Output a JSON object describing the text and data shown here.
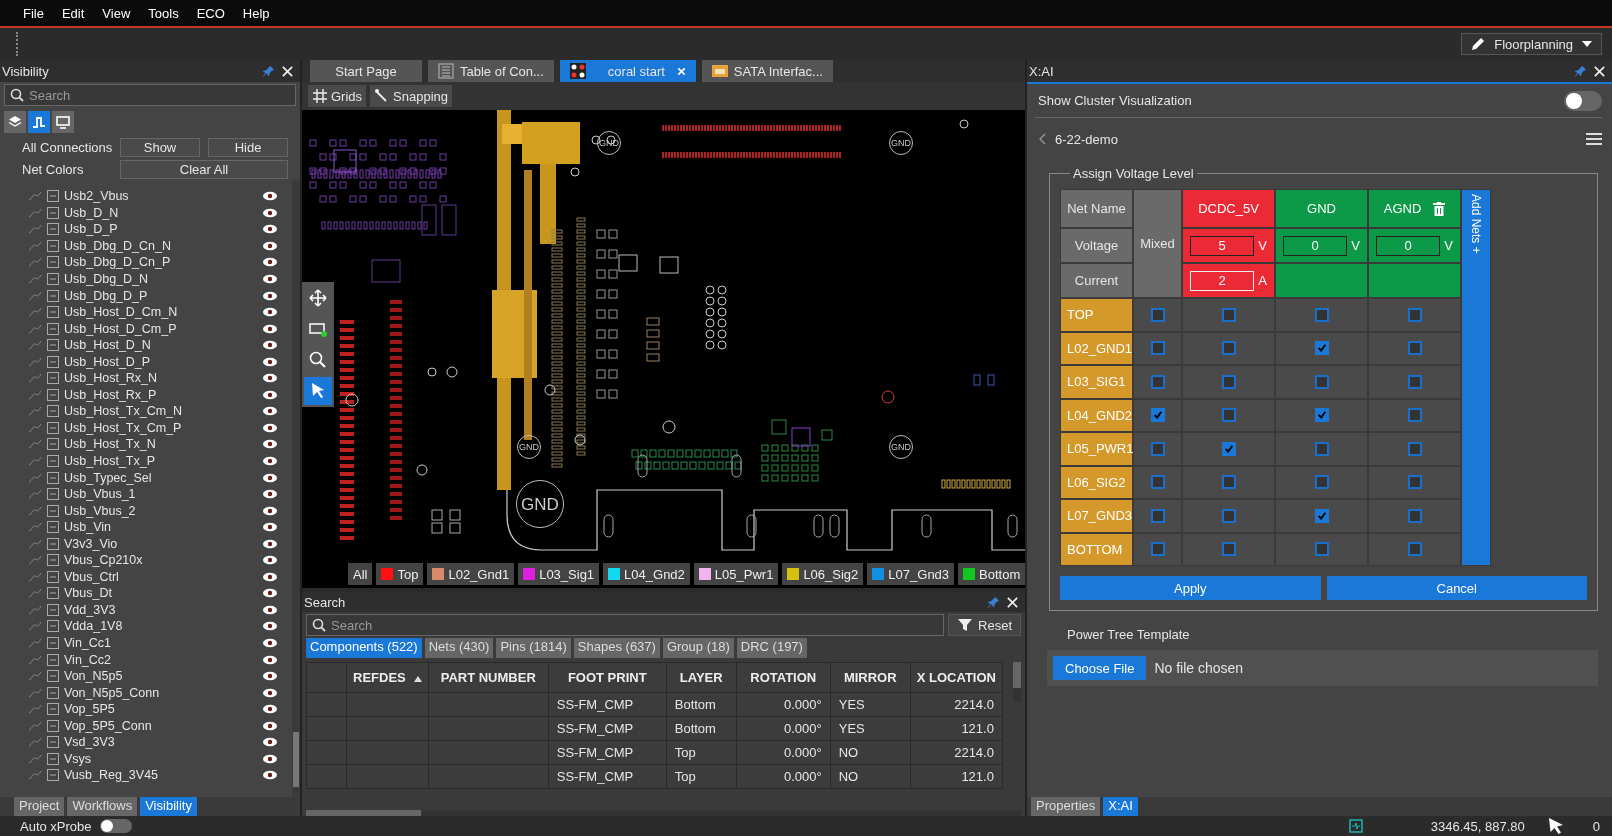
{
  "menu": [
    "File",
    "Edit",
    "View",
    "Tools",
    "ECO",
    "Help"
  ],
  "toolbar": {
    "mode": "Floorplanning"
  },
  "visibility": {
    "title": "Visibility",
    "search_placeholder": "Search",
    "view_icons": [
      {
        "selected": false
      },
      {
        "selected": true
      },
      {
        "selected": false
      }
    ],
    "all_connections": {
      "label": "All Connections",
      "buttons": [
        "Show",
        "Hide"
      ]
    },
    "net_colors": {
      "label": "Net Colors",
      "button": "Clear All"
    },
    "nets": [
      {
        "name": "Usb2_Vbus",
        "visible": true
      },
      {
        "name": "Usb_D_N",
        "visible": true
      },
      {
        "name": "Usb_D_P",
        "visible": true
      },
      {
        "name": "Usb_Dbg_D_Cn_N",
        "visible": true
      },
      {
        "name": "Usb_Dbg_D_Cn_P",
        "visible": true
      },
      {
        "name": "Usb_Dbg_D_N",
        "visible": true
      },
      {
        "name": "Usb_Dbg_D_P",
        "visible": true
      },
      {
        "name": "Usb_Host_D_Cm_N",
        "visible": true
      },
      {
        "name": "Usb_Host_D_Cm_P",
        "visible": true
      },
      {
        "name": "Usb_Host_D_N",
        "visible": true
      },
      {
        "name": "Usb_Host_D_P",
        "visible": true
      },
      {
        "name": "Usb_Host_Rx_N",
        "visible": true
      },
      {
        "name": "Usb_Host_Rx_P",
        "visible": true
      },
      {
        "name": "Usb_Host_Tx_Cm_N",
        "visible": true
      },
      {
        "name": "Usb_Host_Tx_Cm_P",
        "visible": true
      },
      {
        "name": "Usb_Host_Tx_N",
        "visible": true
      },
      {
        "name": "Usb_Host_Tx_P",
        "visible": true
      },
      {
        "name": "Usb_Typec_Sel",
        "visible": true
      },
      {
        "name": "Usb_Vbus_1",
        "visible": true
      },
      {
        "name": "Usb_Vbus_2",
        "visible": true
      },
      {
        "name": "Usb_Vin",
        "visible": true
      },
      {
        "name": "V3v3_Vio",
        "visible": true
      },
      {
        "name": "Vbus_Cp210x",
        "visible": true
      },
      {
        "name": "Vbus_Ctrl",
        "visible": true
      },
      {
        "name": "Vbus_Dt",
        "visible": true
      },
      {
        "name": "Vdd_3V3",
        "visible": true
      },
      {
        "name": "Vdda_1V8",
        "visible": true
      },
      {
        "name": "Vin_Cc1",
        "visible": true
      },
      {
        "name": "Vin_Cc2",
        "visible": true
      },
      {
        "name": "Von_N5p5",
        "visible": true
      },
      {
        "name": "Von_N5p5_Conn",
        "visible": true
      },
      {
        "name": "Vop_5P5",
        "visible": true
      },
      {
        "name": "Vop_5P5_Conn",
        "visible": true
      },
      {
        "name": "Vsd_3V3",
        "visible": true
      },
      {
        "name": "Vsys",
        "visible": true
      },
      {
        "name": "Vusb_Reg_3V45",
        "visible": true
      }
    ],
    "tabs": [
      {
        "label": "Project",
        "selected": false
      },
      {
        "label": "Workflows",
        "selected": false
      },
      {
        "label": "Visibility",
        "selected": true
      }
    ]
  },
  "editor": {
    "tabs": [
      {
        "label": "Start Page",
        "kind": "page",
        "selected": false,
        "closable": false
      },
      {
        "label": "Table of Con...",
        "kind": "table",
        "selected": false,
        "closable": false
      },
      {
        "label": "coral start",
        "kind": "board",
        "selected": true,
        "closable": true
      },
      {
        "label": "SATA Interfac...",
        "kind": "sheet",
        "selected": false,
        "closable": false
      }
    ],
    "tools": [
      {
        "label": "Grids",
        "kind": "grid"
      },
      {
        "label": "Snapping",
        "kind": "snap"
      }
    ],
    "canvas_tools": [
      {
        "kind": "pan",
        "selected": false
      },
      {
        "kind": "add",
        "selected": false
      },
      {
        "kind": "zoom",
        "selected": false
      },
      {
        "kind": "select",
        "selected": true
      }
    ],
    "canvas_labels": [
      "GND",
      "GND",
      "GND",
      "GND",
      "GND"
    ],
    "all_layers": "All",
    "layers": [
      {
        "name": "Top",
        "color": "#ff1010"
      },
      {
        "name": "L02_Gnd1",
        "color": "#d98a6a"
      },
      {
        "name": "L03_Sig1",
        "color": "#e020e0"
      },
      {
        "name": "L04_Gnd2",
        "color": "#10d8f0"
      },
      {
        "name": "L05_Pwr1",
        "color": "#f2b4f0"
      },
      {
        "name": "L06_Sig2",
        "color": "#d8c010"
      },
      {
        "name": "L07_Gnd3",
        "color": "#1090e0"
      },
      {
        "name": "Bottom",
        "color": "#10c820"
      }
    ]
  },
  "search": {
    "title": "Search",
    "placeholder": "Search",
    "reset": "Reset",
    "tabs": [
      {
        "label": "Components (522)",
        "selected": true
      },
      {
        "label": "Nets (430)",
        "selected": false
      },
      {
        "label": "Pins (1814)",
        "selected": false
      },
      {
        "label": "Shapes (637)",
        "selected": false
      },
      {
        "label": "Group (18)",
        "selected": false
      },
      {
        "label": "DRC (197)",
        "selected": false
      }
    ],
    "columns": [
      {
        "sorted": false
      },
      {
        "label": "REFDES",
        "sorted": true
      },
      {
        "label": "PART NUMBER",
        "sorted": false
      },
      {
        "label": "FOOT PRINT",
        "sorted": false
      },
      {
        "label": "LAYER",
        "sorted": false
      },
      {
        "label": "ROTATION",
        "sorted": false
      },
      {
        "label": "MIRROR",
        "sorted": false
      },
      {
        "label": "X LOCATION",
        "sorted": false
      }
    ],
    "rows": [
      [
        "",
        "",
        "",
        "SS-FM_CMP",
        "Bottom",
        "0.000°",
        "YES",
        "2214.0"
      ],
      [
        "",
        "",
        "",
        "SS-FM_CMP",
        "Bottom",
        "0.000°",
        "YES",
        "121.0"
      ],
      [
        "",
        "",
        "",
        "SS-FM_CMP",
        "Top",
        "0.000°",
        "NO",
        "2214.0"
      ],
      [
        "",
        "",
        "",
        "SS-FM_CMP",
        "Top",
        "0.000°",
        "NO",
        "121.0"
      ]
    ]
  },
  "xai": {
    "title": "X:AI",
    "cluster_toggle": {
      "label": "Show Cluster Visualization",
      "on": false
    },
    "project": "6-22-demo",
    "voltage_table": {
      "legend": "Assign Voltage Level",
      "net_name": "Net Name",
      "voltage": "Voltage",
      "current": "Current",
      "mixed": "Mixed",
      "add_nets": "Add Nets +",
      "nets": [
        {
          "name": "DCDC_5V",
          "color": "#ec2a36",
          "voltage": "5",
          "voltage_unit": "V",
          "current": "2",
          "current_unit": "A",
          "deletable": false
        },
        {
          "name": "GND",
          "color": "#0c9a48",
          "voltage": "0",
          "voltage_unit": "V",
          "deletable": false
        },
        {
          "name": "AGND",
          "color": "#0c9a48",
          "voltage": "0",
          "voltage_unit": "V",
          "deletable": true
        }
      ],
      "layers": [
        {
          "name": "TOP",
          "mixed": false,
          "checked": [
            false,
            false,
            false
          ]
        },
        {
          "name": "L02_GND1",
          "mixed": false,
          "checked": [
            false,
            true,
            false
          ]
        },
        {
          "name": "L03_SIG1",
          "mixed": false,
          "checked": [
            false,
            false,
            false
          ]
        },
        {
          "name": "L04_GND2",
          "mixed": true,
          "checked": [
            false,
            true,
            false
          ]
        },
        {
          "name": "L05_PWR1",
          "mixed": false,
          "checked": [
            true,
            false,
            false
          ]
        },
        {
          "name": "L06_SIG2",
          "mixed": false,
          "checked": [
            false,
            false,
            false
          ]
        },
        {
          "name": "L07_GND3",
          "mixed": false,
          "checked": [
            false,
            true,
            false
          ]
        },
        {
          "name": "BOTTOM",
          "mixed": false,
          "checked": [
            false,
            false,
            false
          ]
        }
      ],
      "buttons": [
        "Apply",
        "Cancel"
      ]
    },
    "power_tree": {
      "label": "Power Tree Template",
      "button": "Choose File",
      "status": "No file chosen"
    },
    "tabs": [
      {
        "label": "Properties",
        "selected": false
      },
      {
        "label": "X:AI",
        "selected": true
      }
    ]
  },
  "status_bar": {
    "auto_xprobe": {
      "label": "Auto xProbe",
      "on": false
    },
    "coordinates": "3346.45, 887.80",
    "count": "0"
  }
}
